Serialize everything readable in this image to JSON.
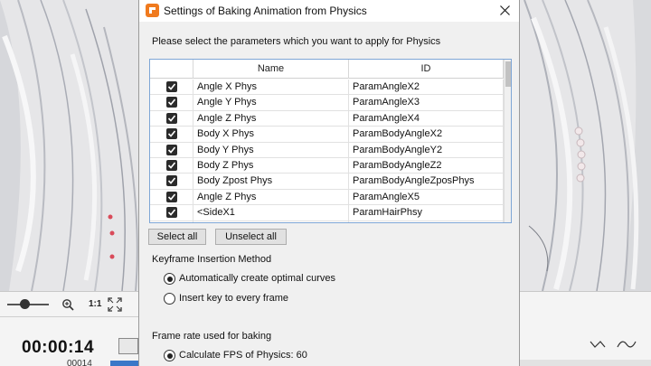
{
  "dialog": {
    "title": "Settings of Baking Animation from Physics",
    "instruction": "Please select the parameters which you want to apply for Physics",
    "table": {
      "columns": [
        "",
        "Name",
        "ID"
      ],
      "rows": [
        {
          "checked": true,
          "name": "Angle X Phys",
          "id": "ParamAngleX2"
        },
        {
          "checked": true,
          "name": "Angle Y Phys",
          "id": "ParamAngleX3"
        },
        {
          "checked": true,
          "name": "Angle Z Phys",
          "id": "ParamAngleX4"
        },
        {
          "checked": true,
          "name": "Body X Phys",
          "id": "ParamBodyAngleX2"
        },
        {
          "checked": true,
          "name": "Body Y Phys",
          "id": "ParamBodyAngleY2"
        },
        {
          "checked": true,
          "name": "Body Z Phys",
          "id": "ParamBodyAngleZ2"
        },
        {
          "checked": true,
          "name": "Body Zpost Phys",
          "id": "ParamBodyAngleZposPhys"
        },
        {
          "checked": true,
          "name": "Angle Z Phys",
          "id": "ParamAngleX5"
        },
        {
          "checked": true,
          "name": "<SideX1",
          "id": "ParamHairPhsy"
        }
      ]
    },
    "select_all_label": "Select all",
    "unselect_all_label": "Unselect all",
    "keyframe_section": {
      "title": "Keyframe Insertion Method",
      "options": [
        {
          "label": "Automatically create optimal curves",
          "selected": true
        },
        {
          "label": "Insert key to every frame",
          "selected": false
        }
      ]
    },
    "framerate_section": {
      "title": "Frame rate used for baking",
      "options": [
        {
          "label": "Calculate FPS of Physics: 60",
          "selected": true
        }
      ]
    }
  },
  "background_app": {
    "zoom_ratio": "1:1",
    "timecode": "00:00:14",
    "frame_counter": "00014",
    "accent_color": "#3a78c8"
  },
  "icons": {
    "app": "cubism-logo-icon",
    "close": "close-icon",
    "zoom": "zoom-in-icon",
    "fit": "fit-to-screen-icon",
    "curve": "curve-editor-icon"
  }
}
